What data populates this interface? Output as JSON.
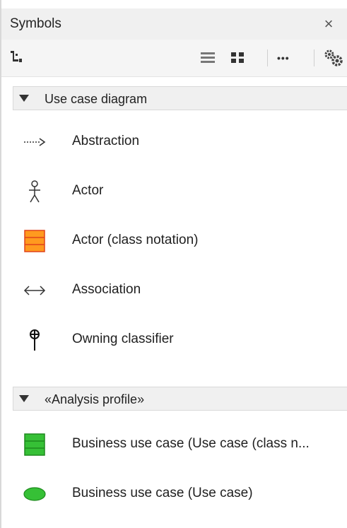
{
  "panel": {
    "title": "Symbols",
    "close_glyph": "×"
  },
  "toolbar": {
    "items": [
      {
        "name": "tree-view-icon"
      },
      {
        "name": "list-view-icon"
      },
      {
        "name": "grid-view-icon"
      },
      {
        "name": "more-options-icon",
        "glyph": "•••"
      },
      {
        "name": "settings-gears-icon"
      }
    ]
  },
  "sections": [
    {
      "label": "Use case diagram",
      "items": [
        {
          "label": "Abstraction",
          "icon": "dotted-arrow-icon"
        },
        {
          "label": "Actor",
          "icon": "stick-figure-icon"
        },
        {
          "label": "Actor (class notation)",
          "icon": "orange-class-box-icon"
        },
        {
          "label": "Association",
          "icon": "double-arrow-icon"
        },
        {
          "label": "Owning classifier",
          "icon": "circle-plus-pin-icon"
        }
      ]
    },
    {
      "label": "«Analysis profile»",
      "items": [
        {
          "label": "Business use case (Use case (class n...",
          "icon": "green-class-box-icon"
        },
        {
          "label": "Business use case (Use case)",
          "icon": "green-ellipse-icon"
        }
      ]
    }
  ],
  "colors": {
    "orange_fill": "#ff9a1f",
    "orange_line": "#e0431a",
    "green_fill": "#36c036",
    "green_line": "#1e8a1e"
  }
}
